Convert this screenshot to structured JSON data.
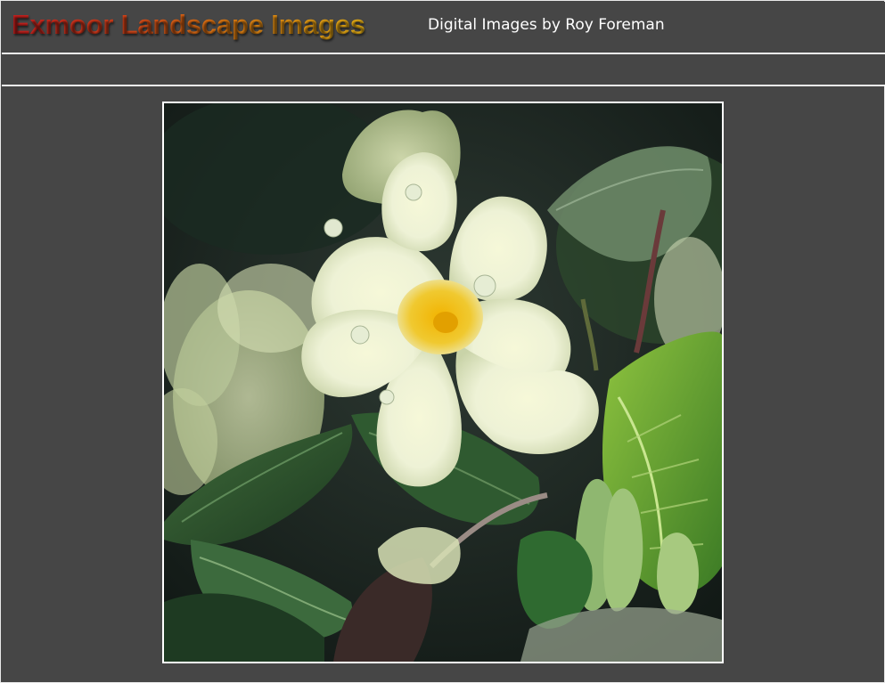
{
  "header": {
    "brand_title": "Exmoor Landscape Images",
    "byline": "Digital Images by Roy Foreman"
  },
  "photo": {
    "subject_icon": "primrose-flower-photo"
  },
  "colors": {
    "background": "#464646",
    "rule": "#f0f0f0",
    "brand_gradient_start": "#c81e1e",
    "brand_gradient_end": "#e9b215",
    "byline_text": "#ffffff"
  }
}
